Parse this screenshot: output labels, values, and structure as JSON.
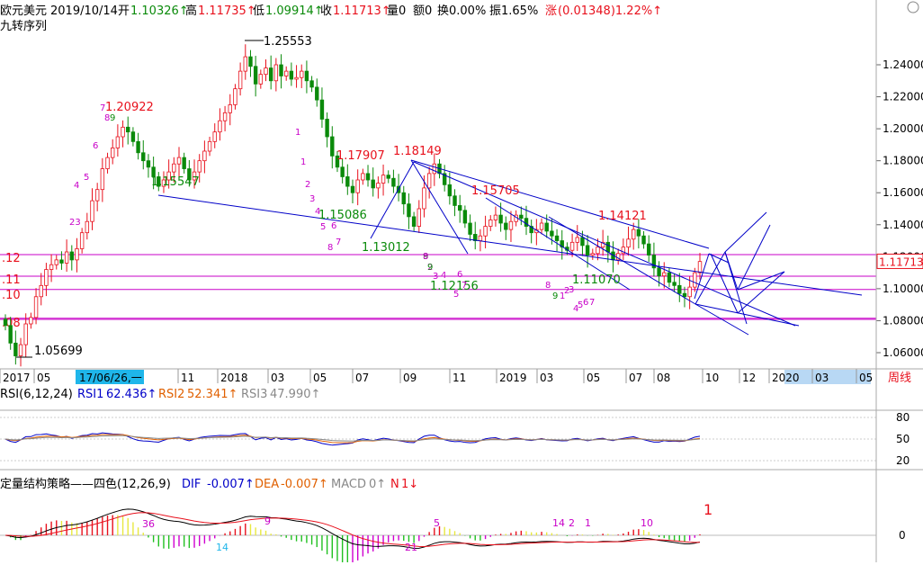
{
  "header": {
    "title": "欧元美元",
    "date": "2019/10/14",
    "open_label": "开",
    "open_value": "1.10326↑",
    "high_label": "高",
    "high_value": "1.11735↑",
    "low_label": "低",
    "low_value": "1.09914↑",
    "close_label": "收",
    "close_value": "1.11713↑",
    "volume": "量0",
    "amount": "额0",
    "turnover": "换0.00%",
    "amplitude": "振1.65%",
    "change_label": "涨",
    "change_value": "(0.01348)1.22%↑",
    "subtitle": "九转序列"
  },
  "colors": {
    "up": "#e8101c",
    "down": "#0a8a0a",
    "line": "#0000c8",
    "magenta": "#c800c8",
    "grid": "#c8c8c8"
  },
  "chart_data": [
    {
      "type": "candlestick",
      "title": "欧元美元 周线",
      "period": "周线",
      "y_ticks": [
        1.06,
        1.08,
        1.1,
        1.12,
        1.14,
        1.16,
        1.18,
        1.2,
        1.22,
        1.24
      ],
      "y_tick_labels": [
        "1.06000",
        "1.08000",
        "1.10000",
        "1.12000",
        "1.14000",
        "1.16000",
        "1.18000",
        "1.20000",
        "1.22000",
        "1.24000"
      ],
      "ylim": [
        1.05,
        1.26
      ],
      "x_labels": [
        "2017",
        "05",
        "17/06/26,一",
        "11",
        "2018",
        "03",
        "05",
        "07",
        "09",
        "11",
        "2019",
        "03",
        "05",
        "07",
        "08",
        "10",
        "12",
        "2020",
        "03",
        "05"
      ],
      "price_labels": [
        {
          "text": "1.25553",
          "value": 1.25553,
          "color": "black"
        },
        {
          "text": "1.20922",
          "value": 1.20922,
          "color": "red"
        },
        {
          "text": "1.17907",
          "value": 1.17907,
          "color": "red"
        },
        {
          "text": "1.18149",
          "value": 1.18149,
          "color": "red"
        },
        {
          "text": "1.15705",
          "value": 1.15705,
          "color": "red"
        },
        {
          "text": "1.14121",
          "value": 1.14121,
          "color": "red"
        },
        {
          "text": "1.15547",
          "value": 1.15547,
          "color": "green"
        },
        {
          "text": "1.15086",
          "value": 1.15086,
          "color": "green"
        },
        {
          "text": "1.13012",
          "value": 1.13012,
          "color": "green"
        },
        {
          "text": "1.12156",
          "value": 1.12156,
          "color": "green"
        },
        {
          "text": "1.11070",
          "value": 1.1107,
          "color": "green"
        },
        {
          "text": "1.05699",
          "value": 1.05699,
          "color": "black"
        }
      ],
      "current_price": "1.11713",
      "left_edge_labels": [
        ".12",
        ".11",
        ".10",
        ".08"
      ],
      "horizontal_levels": [
        1.1213,
        1.1078,
        1.0995,
        1.0815,
        1.0808
      ],
      "close_series": [
        1.077,
        1.066,
        1.058,
        1.065,
        1.078,
        1.082,
        1.095,
        1.102,
        1.112,
        1.115,
        1.118,
        1.116,
        1.123,
        1.118,
        1.125,
        1.135,
        1.142,
        1.155,
        1.162,
        1.175,
        1.182,
        1.188,
        1.195,
        1.201,
        1.198,
        1.192,
        1.185,
        1.18,
        1.176,
        1.17,
        1.164,
        1.168,
        1.173,
        1.178,
        1.182,
        1.175,
        1.168,
        1.173,
        1.18,
        1.186,
        1.192,
        1.198,
        1.205,
        1.21,
        1.215,
        1.225,
        1.236,
        1.245,
        1.239,
        1.228,
        1.234,
        1.238,
        1.23,
        1.24,
        1.233,
        1.236,
        1.231,
        1.232,
        1.236,
        1.23,
        1.226,
        1.218,
        1.206,
        1.195,
        1.183,
        1.176,
        1.17,
        1.164,
        1.16,
        1.168,
        1.172,
        1.168,
        1.163,
        1.166,
        1.171,
        1.169,
        1.164,
        1.16,
        1.153,
        1.145,
        1.139,
        1.15,
        1.163,
        1.172,
        1.178,
        1.172,
        1.165,
        1.158,
        1.152,
        1.149,
        1.141,
        1.134,
        1.13,
        1.133,
        1.139,
        1.143,
        1.146,
        1.141,
        1.137,
        1.142,
        1.146,
        1.144,
        1.139,
        1.135,
        1.137,
        1.141,
        1.136,
        1.133,
        1.13,
        1.126,
        1.124,
        1.129,
        1.132,
        1.127,
        1.121,
        1.122,
        1.126,
        1.129,
        1.123,
        1.118,
        1.122,
        1.126,
        1.131,
        1.137,
        1.133,
        1.128,
        1.121,
        1.113,
        1.108,
        1.11,
        1.104,
        1.102,
        1.097,
        1.095,
        1.101,
        1.11,
        1.117
      ],
      "series": [
        {
          "name": "趋势线",
          "color": "#0000c8"
        }
      ]
    },
    {
      "type": "line",
      "title": "RSI(6,12,24)",
      "series": [
        {
          "name": "RSI1",
          "value": "62.436↑",
          "color": "#0000c8"
        },
        {
          "name": "RSI2",
          "value": "52.341↑",
          "color": "#e06000"
        },
        {
          "name": "RSI3",
          "value": "47.990↑",
          "color": "#888888"
        }
      ],
      "y_ticks": [
        20,
        50,
        80
      ],
      "ylim": [
        10,
        90
      ]
    },
    {
      "type": "bar",
      "title": "定量结构策略——四色(12,26,9)",
      "series": [
        {
          "name": "DIF",
          "value": "-0.007↑",
          "color": "#0000c8"
        },
        {
          "name": "DEA",
          "value": "-0.007↑",
          "color": "#e06000"
        },
        {
          "name": "MACD",
          "value": "0↑",
          "color": "#888888"
        },
        {
          "name": "N",
          "value": "1↓",
          "color": "#e8101c"
        }
      ],
      "y_ticks": [
        0
      ],
      "marker": "1"
    }
  ],
  "overlay_digits": {
    "magenta": [
      "7",
      "8",
      "9",
      "6",
      "5",
      "4",
      "23",
      "1",
      "1",
      "2",
      "3",
      "4",
      "5",
      "6",
      "8",
      "7",
      "9",
      "2",
      "3",
      "4",
      "5",
      "6",
      "7",
      "8",
      "9",
      "1",
      "2",
      "3",
      "4",
      "5",
      "6",
      "7",
      "8",
      "9"
    ],
    "rsi": {
      "ticks": [
        "80",
        "50",
        "20"
      ]
    },
    "macd_digits": [
      "36",
      "14",
      "9",
      "5",
      "14",
      "2",
      "1",
      "10",
      "21"
    ]
  }
}
